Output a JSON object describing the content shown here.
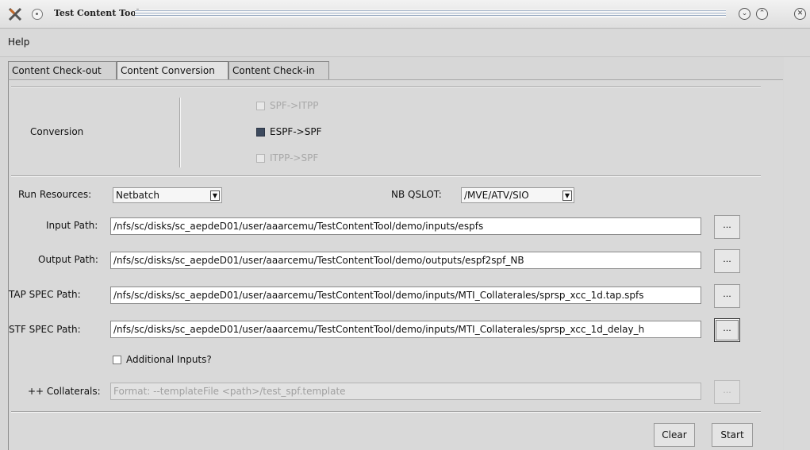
{
  "window": {
    "title": "Test Content Tool"
  },
  "menu": {
    "help": "Help"
  },
  "tabs": [
    {
      "label": "Content Check-out"
    },
    {
      "label": "Content Conversion"
    },
    {
      "label": "Content Check-in"
    }
  ],
  "conversion": {
    "label": "Conversion",
    "options": [
      {
        "label": "SPF->ITPP",
        "checked": false,
        "enabled": false
      },
      {
        "label": "ESPF->SPF",
        "checked": true,
        "enabled": true
      },
      {
        "label": "ITPP->SPF",
        "checked": false,
        "enabled": false
      }
    ]
  },
  "run_resources": {
    "label": "Run Resources:",
    "value": "Netbatch"
  },
  "nb_qslot": {
    "label": "NB QSLOT:",
    "value": "/MVE/ATV/SIO"
  },
  "input_path": {
    "label": "Input Path:",
    "value": "/nfs/sc/disks/sc_aepdeD01/user/aaarcemu/TestContentTool/demo/inputs/espfs"
  },
  "output_path": {
    "label": "Output Path:",
    "value": "/nfs/sc/disks/sc_aepdeD01/user/aaarcemu/TestContentTool/demo/outputs/espf2spf_NB"
  },
  "tap_spec_path": {
    "label": "TAP SPEC Path:",
    "value": "/nfs/sc/disks/sc_aepdeD01/user/aaarcemu/TestContentTool/demo/inputs/MTI_Collaterales/sprsp_xcc_1d.tap.spfs"
  },
  "stf_spec_path": {
    "label": "STF SPEC Path:",
    "value": "/nfs/sc/disks/sc_aepdeD01/user/aaarcemu/TestContentTool/demo/inputs/MTI_Collaterales/sprsp_xcc_1d_delay_h"
  },
  "additional_inputs": {
    "label": "Additional Inputs?",
    "checked": false
  },
  "collaterals": {
    "label": "++ Collaterals:",
    "placeholder": "Format: --templateFile <path>/test_spf.template"
  },
  "browse_label": "...",
  "buttons": {
    "clear": "Clear",
    "start": "Start"
  }
}
